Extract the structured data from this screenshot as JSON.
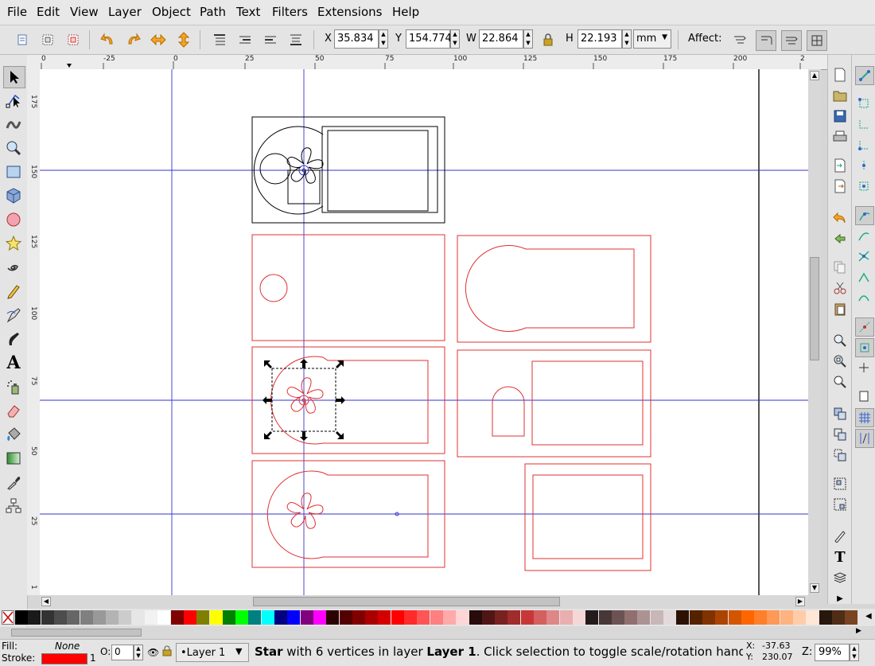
{
  "menu": [
    "File",
    "Edit",
    "View",
    "Layer",
    "Object",
    "Path",
    "Text",
    "Filters",
    "Extensions",
    "Help"
  ],
  "toolbar": {
    "x_label": "X",
    "x_value": "35.834",
    "y_label": "Y",
    "y_value": "154.774",
    "w_label": "W",
    "w_value": "22.864",
    "h_label": "H",
    "h_value": "22.193",
    "unit": "mm",
    "affect_label": "Affect:"
  },
  "ruler": {
    "h_ticks": [
      "0",
      "-25",
      "0",
      "25",
      "50",
      "75",
      "100",
      "125",
      "150",
      "175",
      "200",
      "2"
    ],
    "v_ticks": [
      "175",
      "150",
      "125",
      "100",
      "75",
      "50",
      "25",
      "1"
    ]
  },
  "palette": [
    "#000000",
    "#1a1a1a",
    "#333333",
    "#4d4d4d",
    "#666666",
    "#808080",
    "#999999",
    "#b3b3b3",
    "#cccccc",
    "#e6e6e6",
    "#f2f2f2",
    "#ffffff",
    "#800000",
    "#ff0000",
    "#808000",
    "#ffff00",
    "#008000",
    "#00ff00",
    "#008080",
    "#00ffff",
    "#000080",
    "#0000ff",
    "#800080",
    "#ff00ff",
    "#2b0000",
    "#550000",
    "#800000",
    "#aa0000",
    "#d40000",
    "#ff0000",
    "#ff2a2a",
    "#ff5555",
    "#ff8080",
    "#ffaaaa",
    "#ffd5d5",
    "#280b0b",
    "#501616",
    "#782121",
    "#a02c2c",
    "#c83737",
    "#d35f5f",
    "#de8787",
    "#e9afaf",
    "#f4d7d7",
    "#241c1c",
    "#483737",
    "#6c5353",
    "#916f6f",
    "#ac9393",
    "#c8b7b7",
    "#e3dbdb",
    "#2b1100",
    "#552200",
    "#803300",
    "#aa4400",
    "#d45500",
    "#ff6600",
    "#ff7f2a",
    "#ff9955",
    "#ffb380",
    "#ffccaa",
    "#ffe6d5",
    "#28170b",
    "#502d16",
    "#784421"
  ],
  "status": {
    "fill_label": "Fill:",
    "fill_value": "None",
    "stroke_label": "Stroke:",
    "stroke_width": "1",
    "stroke_color": "#ff0000",
    "opacity_label": "O:",
    "opacity_value": "0",
    "layer": "•Layer 1",
    "message_bold1": "Star",
    "message_mid": " with 6 vertices in layer ",
    "message_bold2": "Layer 1",
    "message_end": ". Click selection to toggle scale/rotation handles",
    "x_label": "X:",
    "x_coord": "-37.63",
    "y_label": "Y:",
    "y_coord": "230.07",
    "zoom_label": "Z:",
    "zoom_value": "99%"
  },
  "colors": {
    "guide": "#3333cc",
    "shape_black": "#000000",
    "shape_red": "#e03030"
  }
}
